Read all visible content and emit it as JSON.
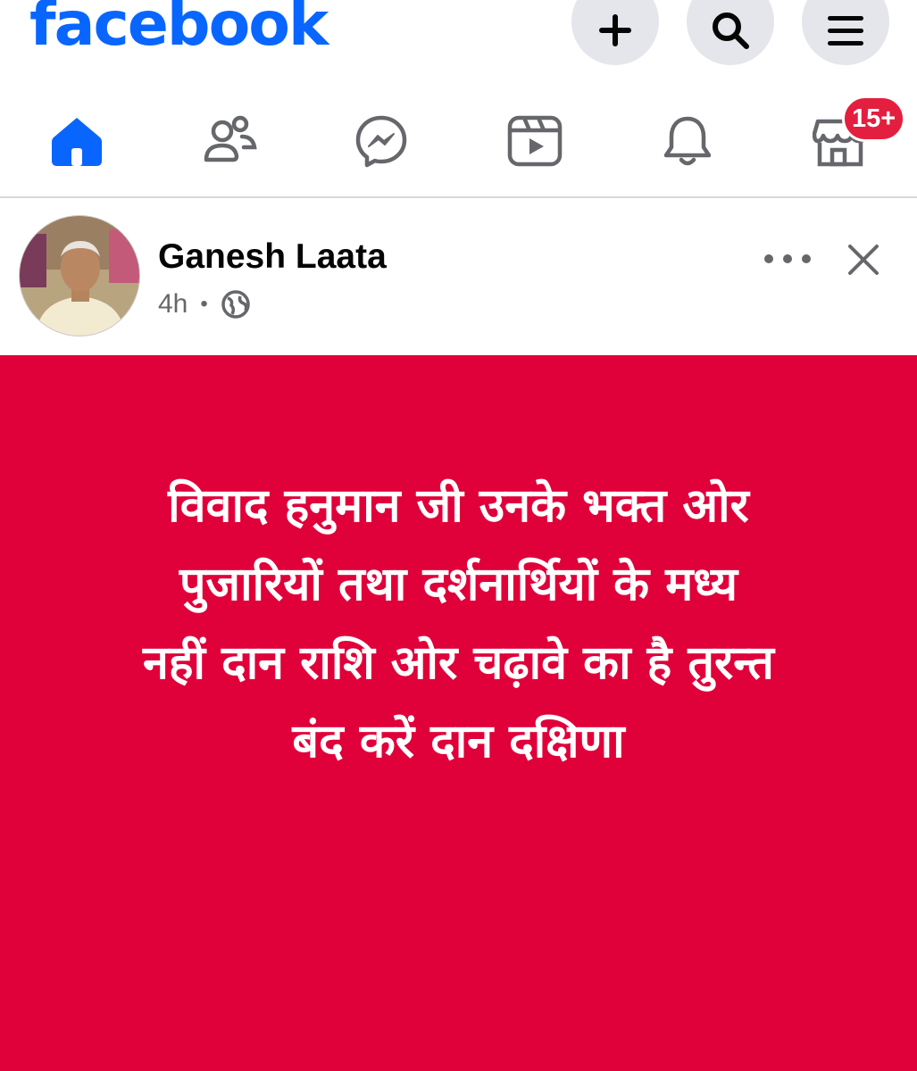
{
  "app": {
    "logo_text": "facebook",
    "brand_color": "#0866ff"
  },
  "header": {
    "actions": [
      {
        "icon": "plus-icon"
      },
      {
        "icon": "search-icon"
      },
      {
        "icon": "menu-icon"
      }
    ]
  },
  "nav": {
    "tabs": [
      {
        "icon": "home-icon",
        "active": true
      },
      {
        "icon": "friends-icon"
      },
      {
        "icon": "messenger-icon"
      },
      {
        "icon": "video-icon"
      },
      {
        "icon": "notifications-icon"
      },
      {
        "icon": "marketplace-icon",
        "badge": "15+"
      }
    ],
    "active_color": "#0866ff",
    "badge_color": "#e41e3f"
  },
  "post": {
    "author": "Ganesh Laata",
    "time": "4h",
    "separator": "•",
    "privacy_icon": "globe-icon",
    "background_color": "#e0003a",
    "text_lines": [
      "विवाद हनुमान जी उनके भक्त ओर",
      "पुजारियों तथा दर्शनार्थियों के मध्य",
      "नहीं  दान राशि ओर चढ़ावे का है तुरन्त",
      "बंद करें  दान दक्षिणा"
    ]
  }
}
